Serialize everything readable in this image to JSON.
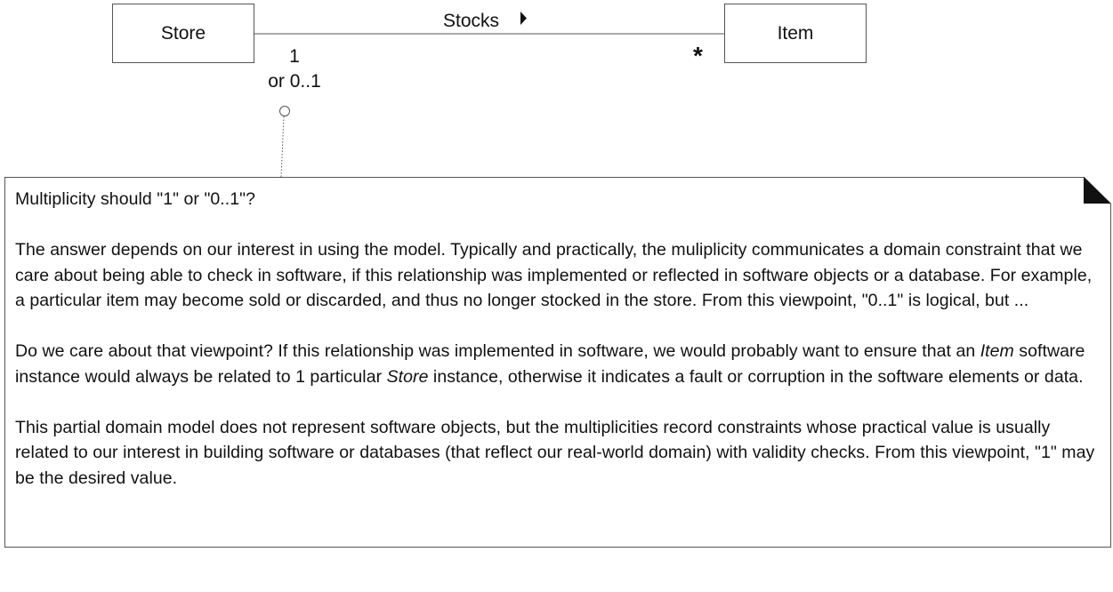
{
  "diagram": {
    "classes": {
      "store": "Store",
      "item": "Item"
    },
    "association": {
      "name": "Stocks",
      "store_multiplicity_line1": "1",
      "store_multiplicity_line2": "or 0..1",
      "item_multiplicity": "*"
    },
    "note": {
      "question": "Multiplicity should \"1\" or \"0..1\"?",
      "paragraph1": "The answer depends on our interest in using the model. Typically and practically, the muliplicity communicates a domain constraint that we care about being able to check in software, if this relationship was implemented or reflected in software objects or a database.  For example, a particular item may become sold or discarded, and thus no longer stocked in the store. From this viewpoint, \"0..1\" is logical, but ...",
      "paragraph2": {
        "part1": "Do we care about that viewpoint? If this relationship was implemented in software, we would probably want to ensure that an ",
        "item_term": "Item",
        "part2": " software instance would always be related to 1 particular ",
        "store_term": "Store",
        "part3": " instance, otherwise it indicates a fault or corruption in the software elements or data."
      },
      "paragraph3": "This partial domain model does not represent software objects, but the multiplicities record constraints whose practical value is usually related to our interest in building software or databases (that reflect our real-world domain) with validity checks. From this viewpoint, \"1\" may be the desired value."
    }
  }
}
